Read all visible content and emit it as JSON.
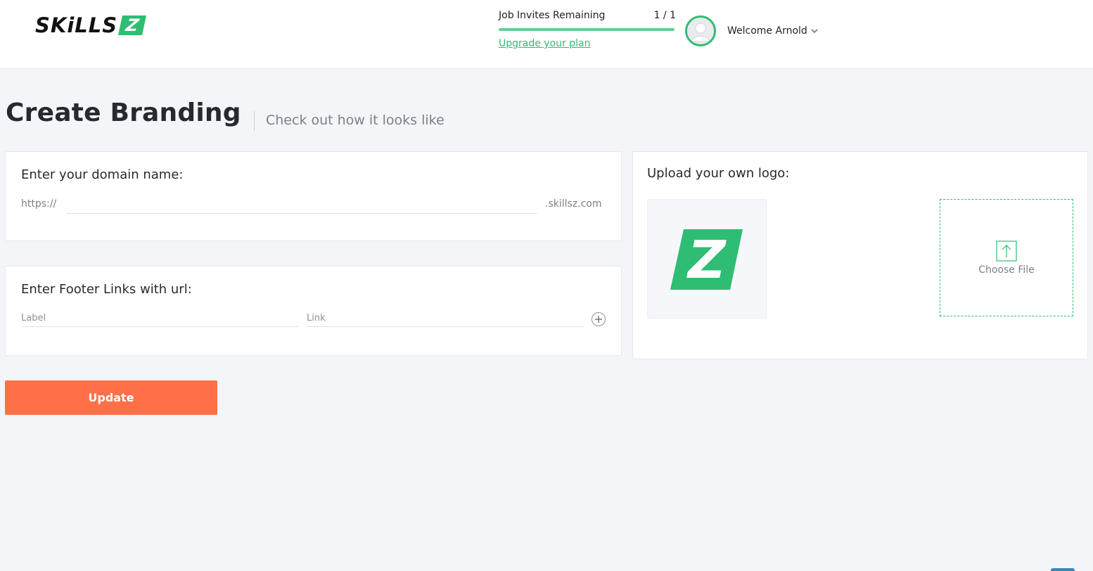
{
  "header": {
    "logo_text": "SKiLLS",
    "logo_mark": "Z",
    "invites_label": "Job Invites Remaining",
    "invites_count": "1 / 1",
    "invites_progress": 1.0,
    "upgrade_link": "Upgrade your plan",
    "welcome_text": "Welcome Arnold",
    "icons": {
      "avatar": "user-avatar-icon",
      "dropdown": "chevron-down-icon"
    }
  },
  "page": {
    "title": "Create Branding",
    "subtitle": "Check out how it looks like"
  },
  "domain": {
    "title": "Enter your domain name:",
    "prefix": "https://",
    "value": "",
    "suffix": ".skillsz.com"
  },
  "footer_links": {
    "title": "Enter Footer Links with url:",
    "label_placeholder": "Label",
    "link_placeholder": "Link",
    "add_icon": "plus-circle-icon"
  },
  "logo_upload": {
    "title": "Upload your own logo:",
    "preview_mark": "Z",
    "choose_file_label": "Choose File",
    "upload_icon": "upload-arrow-icon"
  },
  "actions": {
    "update_label": "Update"
  },
  "colors": {
    "brand_green": "#2ebd72",
    "update_orange": "#ff7049",
    "background": "#f3f5f9"
  }
}
